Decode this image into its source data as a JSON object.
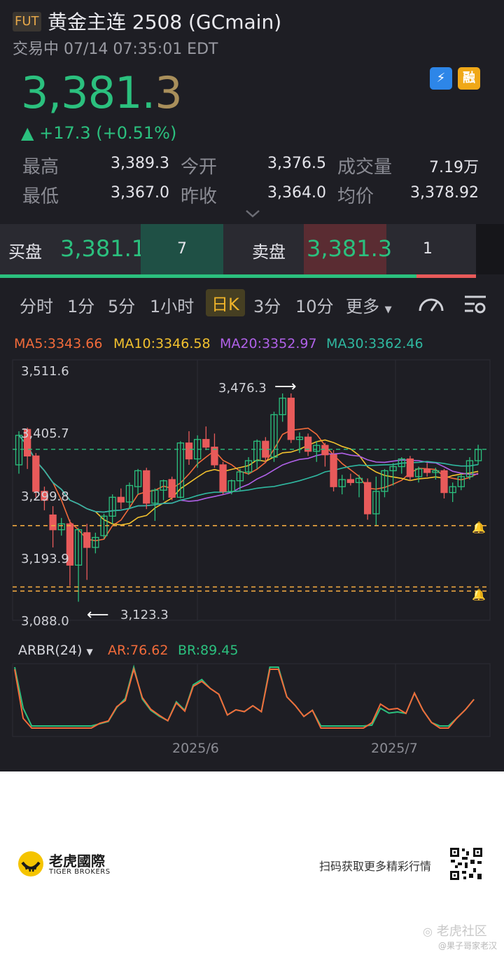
{
  "header": {
    "badge": "FUT",
    "title": "黄金主连 2508 (GCmain)",
    "status": "交易中 07/14 07:35:01 EDT",
    "price_main": "3,381.",
    "price_last": "3",
    "change": "▲ +17.3 (+0.51%)",
    "quick_icons": [
      {
        "icon": "lightning-icon",
        "label": "1",
        "color": "#2d86e8"
      },
      {
        "icon": "margin-icon",
        "label": "融",
        "color": "#f0a818"
      }
    ]
  },
  "stats": {
    "row1": [
      {
        "label": "最高",
        "value": "3,389.3"
      },
      {
        "label": "今开",
        "value": "3,376.5"
      },
      {
        "label": "成交量",
        "value": "7.19万"
      }
    ],
    "row2": [
      {
        "label": "最低",
        "value": "3,367.0"
      },
      {
        "label": "昨收",
        "value": "3,364.0"
      },
      {
        "label": "均价",
        "value": "3,378.92"
      }
    ]
  },
  "orderbook": {
    "bid_label": "买盘",
    "bid_price": "3,381.1",
    "bid_size": "7",
    "ask_label": "卖盘",
    "ask_price": "3,381.3",
    "ask_size": "1",
    "bid_share": 0.875
  },
  "tabs": {
    "items": [
      "分时",
      "1分",
      "5分",
      "1小时",
      "日K",
      "3分",
      "10分",
      "更多"
    ],
    "active": "日K"
  },
  "ma": {
    "ma5": "MA5:3343.66",
    "ma10": "MA10:3346.58",
    "ma20": "MA20:3352.97",
    "ma30": "MA30:3362.46",
    "colors": {
      "ma5": "#f26b3a",
      "ma10": "#f2c12e",
      "ma20": "#b061e8",
      "ma30": "#2fb8a0"
    }
  },
  "chart_data": {
    "type": "candlestick",
    "y_ticks": [
      "3,511.6",
      "3,405.7",
      "3,299.8",
      "3,193.9",
      "3,088.0"
    ],
    "ylim": [
      3088.0,
      3511.6
    ],
    "x_ticks": [
      "2025/6",
      "2025/7"
    ],
    "high_annotation": "3,476.3",
    "low_annotation": "3,123.3",
    "current_price_line": 3381.3,
    "alert_lines": [
      3252.0,
      3148.0,
      3141.0
    ],
    "candles": [
      {
        "o": 3355,
        "h": 3412,
        "l": 3340,
        "c": 3405
      },
      {
        "o": 3415,
        "h": 3418,
        "l": 3348,
        "c": 3370
      },
      {
        "o": 3370,
        "h": 3375,
        "l": 3300,
        "c": 3310
      },
      {
        "o": 3310,
        "h": 3318,
        "l": 3278,
        "c": 3295
      },
      {
        "o": 3270,
        "h": 3285,
        "l": 3215,
        "c": 3245
      },
      {
        "o": 3245,
        "h": 3265,
        "l": 3235,
        "c": 3255
      },
      {
        "o": 3255,
        "h": 3262,
        "l": 3150,
        "c": 3185
      },
      {
        "o": 3185,
        "h": 3248,
        "l": 3123,
        "c": 3245
      },
      {
        "o": 3240,
        "h": 3255,
        "l": 3160,
        "c": 3215
      },
      {
        "o": 3215,
        "h": 3240,
        "l": 3205,
        "c": 3232
      },
      {
        "o": 3235,
        "h": 3272,
        "l": 3230,
        "c": 3268
      },
      {
        "o": 3268,
        "h": 3305,
        "l": 3255,
        "c": 3300
      },
      {
        "o": 3300,
        "h": 3315,
        "l": 3280,
        "c": 3292
      },
      {
        "o": 3292,
        "h": 3325,
        "l": 3280,
        "c": 3320
      },
      {
        "o": 3318,
        "h": 3348,
        "l": 3305,
        "c": 3345
      },
      {
        "o": 3345,
        "h": 3350,
        "l": 3280,
        "c": 3290
      },
      {
        "o": 3290,
        "h": 3315,
        "l": 3260,
        "c": 3312
      },
      {
        "o": 3312,
        "h": 3330,
        "l": 3295,
        "c": 3328
      },
      {
        "o": 3330,
        "h": 3335,
        "l": 3295,
        "c": 3300
      },
      {
        "o": 3300,
        "h": 3395,
        "l": 3298,
        "c": 3392
      },
      {
        "o": 3392,
        "h": 3412,
        "l": 3355,
        "c": 3365
      },
      {
        "o": 3365,
        "h": 3405,
        "l": 3350,
        "c": 3398
      },
      {
        "o": 3398,
        "h": 3420,
        "l": 3380,
        "c": 3385
      },
      {
        "o": 3385,
        "h": 3408,
        "l": 3350,
        "c": 3355
      },
      {
        "o": 3355,
        "h": 3360,
        "l": 3305,
        "c": 3310
      },
      {
        "o": 3310,
        "h": 3330,
        "l": 3305,
        "c": 3328
      },
      {
        "o": 3328,
        "h": 3348,
        "l": 3312,
        "c": 3343
      },
      {
        "o": 3343,
        "h": 3368,
        "l": 3338,
        "c": 3362
      },
      {
        "o": 3362,
        "h": 3398,
        "l": 3348,
        "c": 3395
      },
      {
        "o": 3395,
        "h": 3402,
        "l": 3358,
        "c": 3368
      },
      {
        "o": 3368,
        "h": 3445,
        "l": 3360,
        "c": 3440
      },
      {
        "o": 3440,
        "h": 3476,
        "l": 3428,
        "c": 3468
      },
      {
        "o": 3468,
        "h": 3476,
        "l": 3392,
        "c": 3398
      },
      {
        "o": 3398,
        "h": 3410,
        "l": 3375,
        "c": 3402
      },
      {
        "o": 3402,
        "h": 3408,
        "l": 3370,
        "c": 3378
      },
      {
        "o": 3378,
        "h": 3395,
        "l": 3360,
        "c": 3388
      },
      {
        "o": 3388,
        "h": 3392,
        "l": 3352,
        "c": 3372
      },
      {
        "o": 3372,
        "h": 3380,
        "l": 3310,
        "c": 3318
      },
      {
        "o": 3318,
        "h": 3338,
        "l": 3305,
        "c": 3330
      },
      {
        "o": 3330,
        "h": 3340,
        "l": 3320,
        "c": 3325
      },
      {
        "o": 3325,
        "h": 3338,
        "l": 3300,
        "c": 3332
      },
      {
        "o": 3325,
        "h": 3332,
        "l": 3262,
        "c": 3272
      },
      {
        "o": 3272,
        "h": 3335,
        "l": 3252,
        "c": 3310
      },
      {
        "o": 3310,
        "h": 3348,
        "l": 3300,
        "c": 3345
      },
      {
        "o": 3345,
        "h": 3358,
        "l": 3320,
        "c": 3352
      },
      {
        "o": 3352,
        "h": 3368,
        "l": 3340,
        "c": 3365
      },
      {
        "o": 3365,
        "h": 3370,
        "l": 3328,
        "c": 3335
      },
      {
        "o": 3335,
        "h": 3352,
        "l": 3325,
        "c": 3348
      },
      {
        "o": 3348,
        "h": 3358,
        "l": 3335,
        "c": 3342
      },
      {
        "o": 3342,
        "h": 3350,
        "l": 3330,
        "c": 3345
      },
      {
        "o": 3345,
        "h": 3348,
        "l": 3298,
        "c": 3308
      },
      {
        "o": 3308,
        "h": 3325,
        "l": 3292,
        "c": 3318
      },
      {
        "o": 3318,
        "h": 3340,
        "l": 3312,
        "c": 3335
      },
      {
        "o": 3335,
        "h": 3368,
        "l": 3330,
        "c": 3362
      },
      {
        "o": 3362,
        "h": 3389,
        "l": 3355,
        "c": 3381
      }
    ]
  },
  "indicator": {
    "name": "ARBR(24)",
    "ar": "AR:76.62",
    "br": "BR:89.45",
    "ar_color": "#f26b3a",
    "br_color": "#2bc07e"
  },
  "footer": {
    "brand_cn": "老虎國際",
    "brand_en": "TIGER BROKERS",
    "promo": "扫码获取更多精彩行情",
    "community": "老虎社区",
    "author": "@果子哥家老汉"
  }
}
